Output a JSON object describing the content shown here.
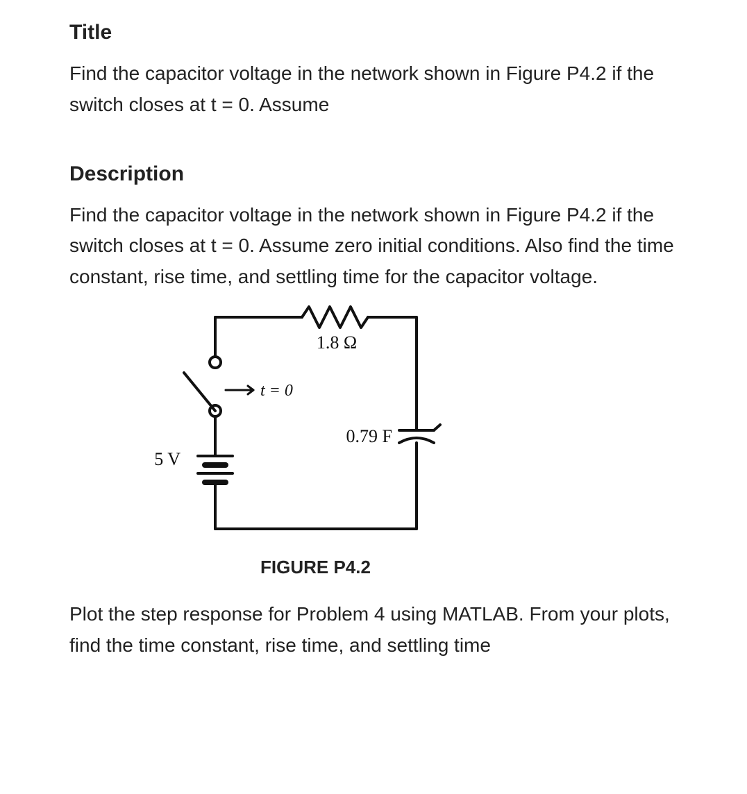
{
  "title_heading": "Title",
  "title_text": "Find the capacitor voltage in the network shown in Figure P4.2 if the switch closes at t = 0. Assume",
  "description_heading": "Description",
  "description_text": "Find the capacitor voltage in the network shown in Figure P4.2 if the switch closes at t = 0. Assume zero initial conditions. Also find the time constant, rise time, and settling time for the capacitor voltage.",
  "circuit": {
    "resistor_label": "1.8 Ω",
    "switch_label": "t = 0",
    "capacitor_label": "0.79 F",
    "source_label": "5 V"
  },
  "figure_caption": "FIGURE P4.2",
  "followup_text": "Plot the step response for Problem 4 using MATLAB. From your plots, find the time constant, rise time, and settling time"
}
